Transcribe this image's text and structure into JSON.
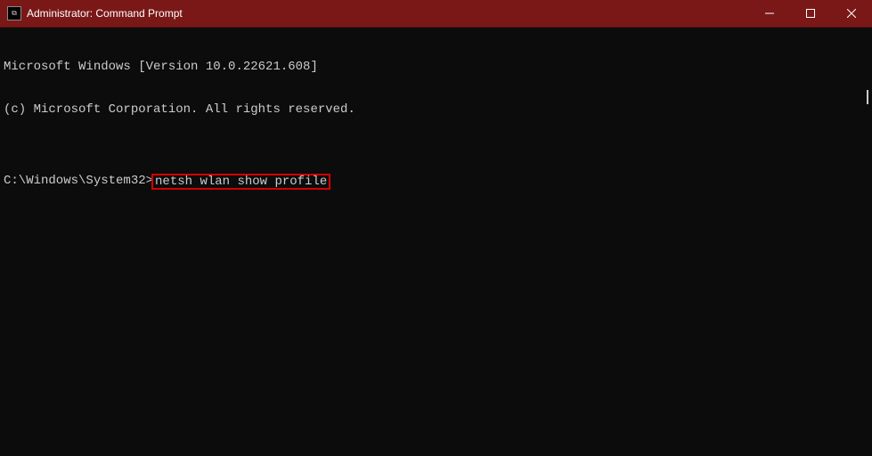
{
  "titlebar": {
    "icon_text": "C:\\",
    "title": "Administrator: Command Prompt"
  },
  "terminal": {
    "line1": "Microsoft Windows [Version 10.0.22621.608]",
    "line2": "(c) Microsoft Corporation. All rights reserved.",
    "blank": "",
    "prompt": "C:\\Windows\\System32>",
    "command": "netsh wlan show profile"
  }
}
